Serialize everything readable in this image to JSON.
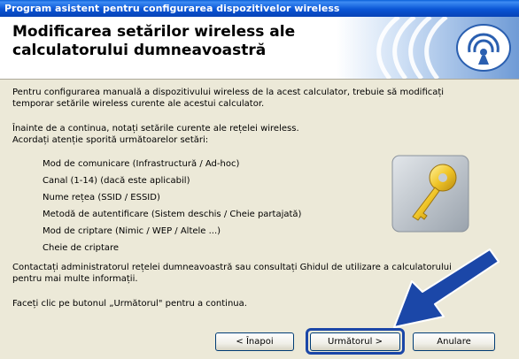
{
  "window": {
    "title": "Program asistent pentru configurarea dispozitivelor wireless"
  },
  "header": {
    "title_line1": "Modificarea setărilor wireless ale",
    "title_line2": "calculatorului dumneavoastră",
    "logo_icon": "wireless-signal-icon"
  },
  "body": {
    "para1_line1": "Pentru configurarea manuală a dispozitivului wireless de la acest calculator, trebuie să modificați",
    "para1_line2": "temporar setările wireless curente ale acestui calculator.",
    "para2_line1": "Înainte de a continua, notați setările curente ale rețelei wireless.",
    "para2_line2": "Acordați atenție sporită următoarelor setări:",
    "settings": [
      "Mod de comunicare (Infrastructură / Ad-hoc)",
      "Canal (1-14) (dacă este aplicabil)",
      "Nume rețea (SSID / ESSID)",
      "Metodă de autentificare (Sistem deschis / Cheie partajată)",
      "Mod de criptare (Nimic / WEP / Altele ...)",
      "Cheie de criptare"
    ],
    "para3_line1": "Contactați administratorul rețelei dumneavoastră sau consultați Ghidul de utilizare a calculatorului",
    "para3_line2": "pentru mai multe informații.",
    "para4": "Faceți clic pe butonul „Următorul\" pentru a continua.",
    "key_icon": "key-icon"
  },
  "buttons": {
    "back": "< Înapoi",
    "next": "Următorul >",
    "cancel": "Anulare"
  },
  "colors": {
    "titlebar": "#0a55d5",
    "arrow": "#1b47a8",
    "dialog_bg": "#ece9d8"
  }
}
